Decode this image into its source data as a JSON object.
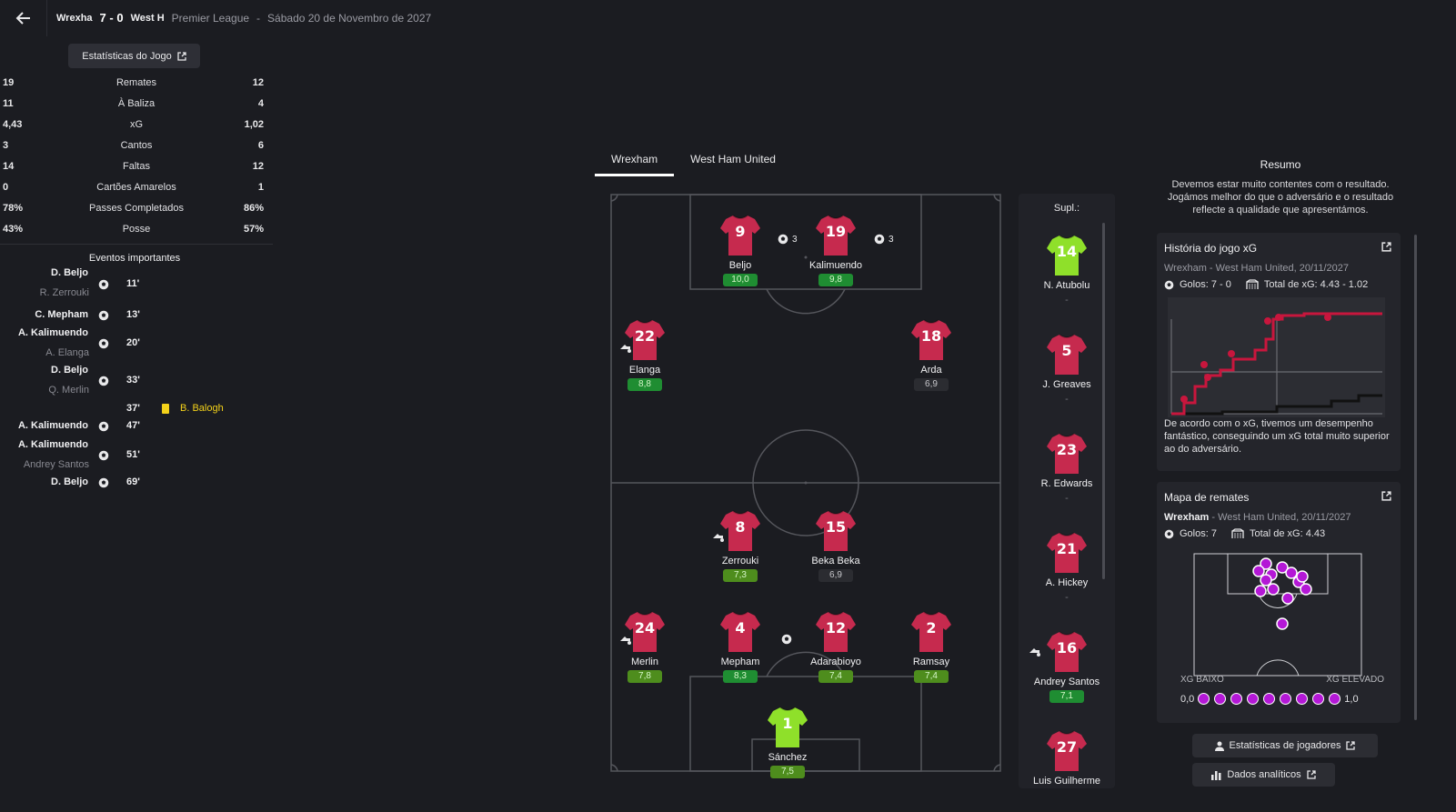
{
  "header": {
    "home_team": "Wrexha",
    "score": "7 - 0",
    "away_team": "West H",
    "competition": "Premier League",
    "separator": "-",
    "date": "Sábado 20 de Novembro de 2027"
  },
  "stats": {
    "button_label": "Estatísticas do Jogo",
    "rows": [
      {
        "home": "19",
        "label": "Remates",
        "away": "12"
      },
      {
        "home": "11",
        "label": "À Baliza",
        "away": "4"
      },
      {
        "home": "4,43",
        "label": "xG",
        "away": "1,02"
      },
      {
        "home": "3",
        "label": "Cantos",
        "away": "6"
      },
      {
        "home": "14",
        "label": "Faltas",
        "away": "12"
      },
      {
        "home": "0",
        "label": "Cartões Amarelos",
        "away": "1"
      },
      {
        "home": "78%",
        "label": "Passes Completados",
        "away": "86%"
      },
      {
        "home": "43%",
        "label": "Posse",
        "away": "57%"
      }
    ]
  },
  "events": {
    "title": "Eventos importantes",
    "items": [
      {
        "scorer": "D. Beljo",
        "assist": "R. Zerrouki",
        "minute": "11'"
      },
      {
        "scorer": "C. Mepham",
        "assist": "",
        "minute": "13'"
      },
      {
        "scorer": "A. Kalimuendo",
        "assist": "A. Elanga",
        "minute": "20'"
      },
      {
        "scorer": "D. Beljo",
        "assist": "Q. Merlin",
        "minute": "33'"
      },
      {
        "card_player": "B. Balogh",
        "minute": "37'"
      },
      {
        "scorer": "A. Kalimuendo",
        "assist": "",
        "minute": "47'"
      },
      {
        "scorer": "A. Kalimuendo",
        "assist": "Andrey Santos",
        "minute": "51'"
      },
      {
        "scorer": "D. Beljo",
        "assist": "",
        "minute": "69'"
      }
    ]
  },
  "tabs": [
    {
      "label": "Wrexham",
      "active": true
    },
    {
      "label": "West Ham United",
      "active": false
    }
  ],
  "lineup": {
    "players": [
      {
        "number": "9",
        "name": "Beljo",
        "rating": "10,0",
        "rating_color": "green",
        "goals": "3"
      },
      {
        "number": "19",
        "name": "Kalimuendo",
        "rating": "9,8",
        "rating_color": "green",
        "goals": "3"
      },
      {
        "number": "22",
        "name": "Elanga",
        "rating": "8,8",
        "rating_color": "green"
      },
      {
        "number": "18",
        "name": "Arda",
        "rating": "6,9",
        "rating_color": "dark"
      },
      {
        "number": "8",
        "name": "Zerrouki",
        "rating": "7,3",
        "rating_color": "lime"
      },
      {
        "number": "15",
        "name": "Beka Beka",
        "rating": "6,9",
        "rating_color": "dark"
      },
      {
        "number": "24",
        "name": "Merlin",
        "rating": "7,8",
        "rating_color": "lime"
      },
      {
        "number": "4",
        "name": "Mepham",
        "rating": "8,3",
        "rating_color": "green"
      },
      {
        "number": "12",
        "name": "Adarabioyo",
        "rating": "7,4",
        "rating_color": "lime"
      },
      {
        "number": "2",
        "name": "Ramsay",
        "rating": "7,4",
        "rating_color": "lime"
      },
      {
        "number": "1",
        "name": "Sánchez",
        "rating": "7,5",
        "rating_color": "lime"
      }
    ]
  },
  "subs": {
    "title": "Supl.:",
    "items": [
      {
        "number": "14",
        "name": "N. Atubolu",
        "rating": "-",
        "keeper": true
      },
      {
        "number": "5",
        "name": "J. Greaves",
        "rating": "-"
      },
      {
        "number": "23",
        "name": "R. Edwards",
        "rating": "-"
      },
      {
        "number": "21",
        "name": "A. Hickey",
        "rating": "-"
      },
      {
        "number": "16",
        "name": "Andrey Santos",
        "rating": "7,1"
      },
      {
        "number": "27",
        "name": "Luis Guilherme",
        "rating": ""
      }
    ]
  },
  "summary": {
    "title": "Resumo",
    "text": "Devemos estar muito contentes com o resultado. Jogámos melhor do que o adversário e o resultado reflecte a qualidade que apresentámos."
  },
  "xg_story": {
    "title": "História do jogo xG",
    "subtitle": "Wrexham - West Ham United, 20/11/2027",
    "goals": "Golos: 7 - 0",
    "total_xg": "Total de xG: 4.43 - 1.02",
    "description": "De acordo com o xG, tivemos um desempenho fantástico, conseguindo um xG total muito superior ao do adversário.",
    "home_color": "#c8163d",
    "away_color": "#111111"
  },
  "shot_map": {
    "title": "Mapa de remates",
    "team": "Wrexham",
    "subtitle_rest": " - West Ham United, 20/11/2027",
    "goals": "Golos: 7",
    "total_xg": "Total de xG: 4.43",
    "legend_low": "XG BAIXO",
    "legend_high": "XG ELEVADO",
    "scale_min": "0,0",
    "scale_max": "1,0",
    "marker_color": "#b418d6"
  },
  "buttons": {
    "player_stats": "Estatísticas de jogadores",
    "analytics": "Dados analíticos"
  },
  "colors": {
    "shirt": "#c62a4e",
    "keeper_shirt": "#8fe02a",
    "rating_green": "#1f8d32"
  }
}
